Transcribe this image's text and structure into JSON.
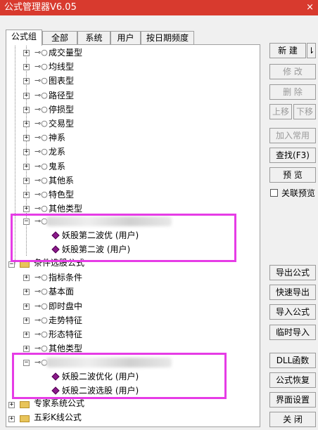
{
  "window": {
    "title": "公式管理器V6.05",
    "close": "×"
  },
  "tabs": [
    "公式组",
    "全部",
    "系统",
    "用户",
    "按日期频度"
  ],
  "tree": {
    "items": [
      "成交量型",
      "均线型",
      "图表型",
      "路径型",
      "停损型",
      "交易型",
      "神系",
      "龙系",
      "鬼系",
      "其他系",
      "特色型",
      "其他类型"
    ],
    "group1_children": [
      "妖股第二波优 (用户)",
      "妖股第二波 (用户)"
    ],
    "section2": "条件选股公式",
    "section2_items": [
      "指标条件",
      "基本面",
      "即时盘中",
      "走势特征",
      "形态特征",
      "其他类型"
    ],
    "group2_children": [
      "妖股二波优化 (用户)",
      "妖股二波选股 (用户)"
    ],
    "section3": "专家系统公式",
    "section4": "五彩K线公式"
  },
  "buttons": {
    "new": "新 建",
    "new_arrow": "⇂",
    "modify": "修 改",
    "delete": "删 除",
    "move_up": "上移",
    "move_down": "下移",
    "add_common": "加入常用",
    "find": "查找(F3)",
    "preview": "预 览",
    "link_preview": "关联预览",
    "export": "导出公式",
    "quick_export": "快速导出",
    "import": "导入公式",
    "temp_import": "临时导入",
    "dll": "DLL函数",
    "restore": "公式恢复",
    "ui_settings": "界面设置",
    "close": "关 闭"
  },
  "colors": {
    "title_bar": "#d83a2e",
    "highlight": "#e63ce6",
    "formula_icon": "#8a1a8a"
  }
}
